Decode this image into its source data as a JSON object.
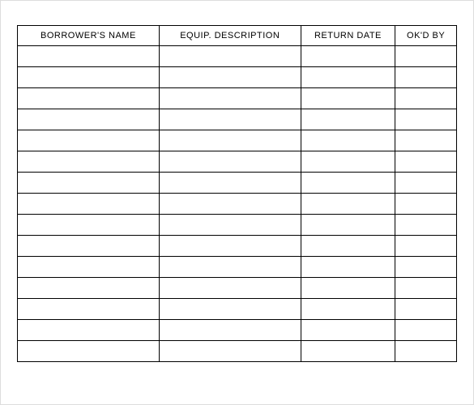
{
  "table": {
    "headers": [
      "BORROWER'S NAME",
      "EQUIP. DESCRIPTION",
      "RETURN DATE",
      "OK'D BY"
    ],
    "row_count": 15
  }
}
